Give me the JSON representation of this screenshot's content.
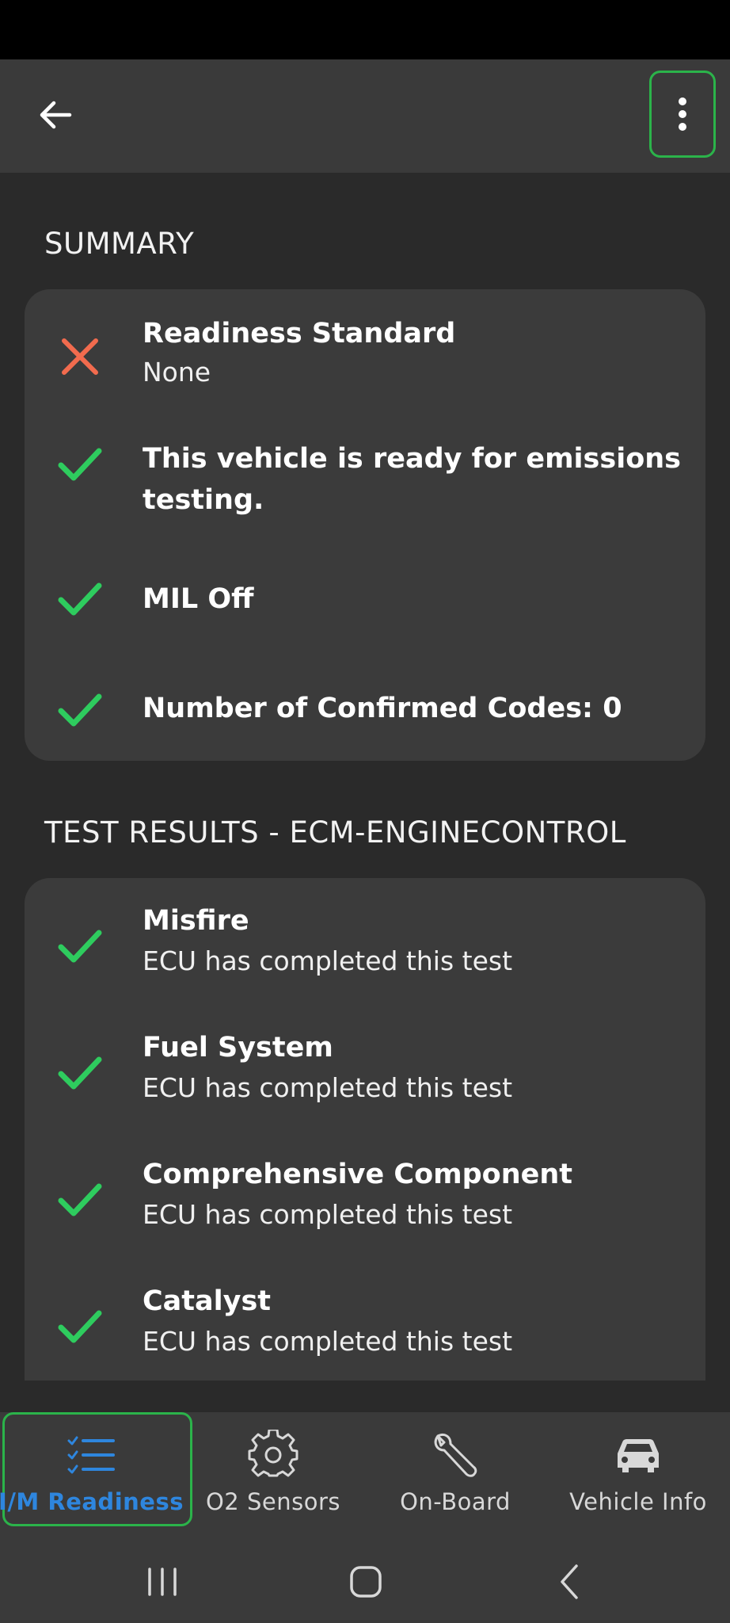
{
  "colors": {
    "background": "#2a2a2a",
    "card": "#3b3b3b",
    "appbar": "#3a3a3a",
    "success": "#2ecc5e",
    "failure": "#f26b4e",
    "active_tab": "#2e86de",
    "highlight_border": "#2bb34a"
  },
  "app_bar": {
    "back_icon": "arrow-left-icon",
    "menu_icon": "more-vert-icon"
  },
  "summary": {
    "heading": "SUMMARY",
    "items": [
      {
        "status": "fail",
        "icon": "x-icon",
        "title": "Readiness Standard",
        "subtitle": "None"
      },
      {
        "status": "pass",
        "icon": "check-icon",
        "title": "This vehicle is ready for emissions testing.",
        "subtitle": ""
      },
      {
        "status": "pass",
        "icon": "check-icon",
        "title": "MIL Off",
        "subtitle": ""
      },
      {
        "status": "pass",
        "icon": "check-icon",
        "title": "Number of Confirmed Codes: 0",
        "subtitle": ""
      }
    ]
  },
  "test_results": {
    "heading": "TEST RESULTS - ECM-ENGINECONTROL",
    "items": [
      {
        "status": "pass",
        "icon": "check-icon",
        "title": "Misfire",
        "subtitle": "ECU has completed this test"
      },
      {
        "status": "pass",
        "icon": "check-icon",
        "title": "Fuel System",
        "subtitle": "ECU has completed this test"
      },
      {
        "status": "pass",
        "icon": "check-icon",
        "title": "Comprehensive Component",
        "subtitle": "ECU has completed this test"
      },
      {
        "status": "pass",
        "icon": "check-icon",
        "title": "Catalyst",
        "subtitle": "ECU has completed this test"
      }
    ]
  },
  "bottom_nav": {
    "items": [
      {
        "label": "I/M Readiness",
        "icon": "checklist-icon",
        "active": true
      },
      {
        "label": "O2 Sensors",
        "icon": "gear-icon",
        "active": false
      },
      {
        "label": "On-Board",
        "icon": "wrench-icon",
        "active": false
      },
      {
        "label": "Vehicle Info",
        "icon": "car-icon",
        "active": false
      }
    ]
  },
  "system_nav": {
    "recents_icon": "recents-icon",
    "home_icon": "home-icon",
    "back_icon": "system-back-icon"
  }
}
